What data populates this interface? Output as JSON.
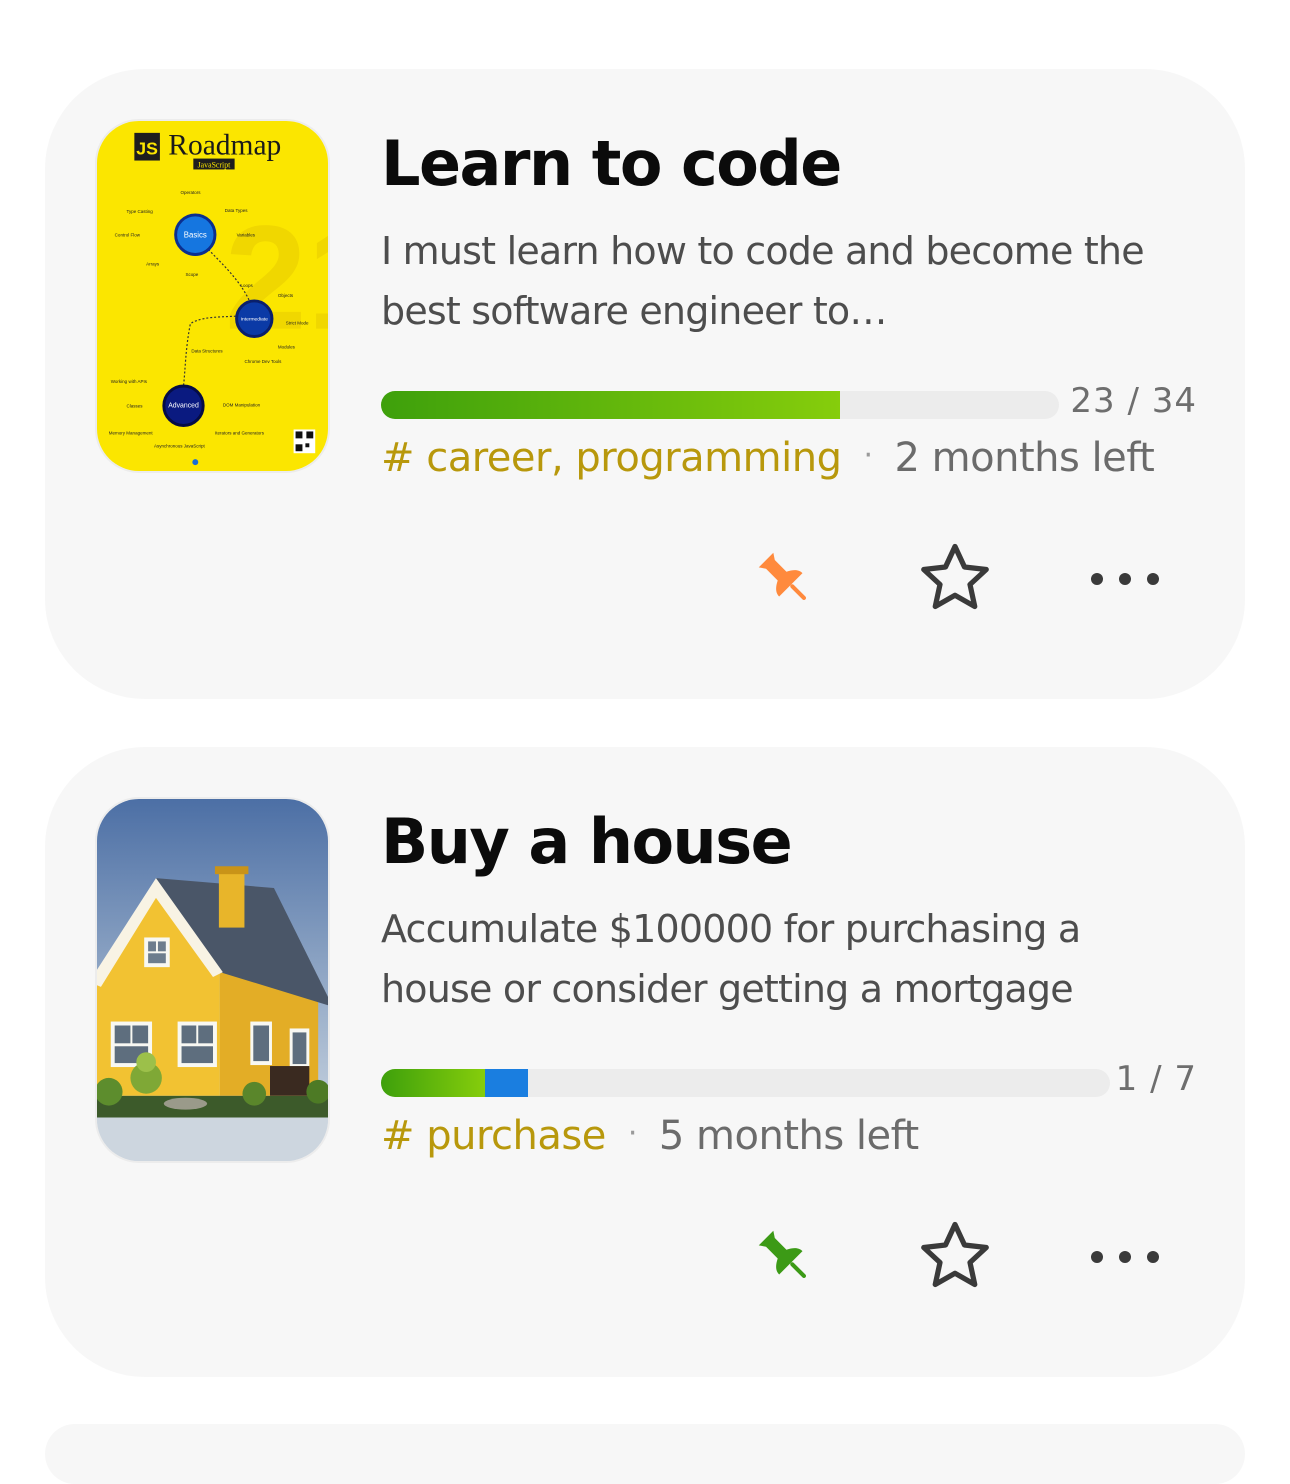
{
  "goals": [
    {
      "title": "Learn to code",
      "description": "I must learn how to code and become the best software engineer to…",
      "progress": {
        "done": 23,
        "total": 34,
        "label": "23 / 34"
      },
      "tags": "# career, programming",
      "separator": "·",
      "deadline": "2 months left",
      "pinned": true,
      "pin_color": "#ff8a3d",
      "thumbnail": {
        "type": "roadmap-poster",
        "badge": "JS",
        "heading": "Roadmap",
        "subheading": "JavaScript",
        "nodes": [
          "Basics",
          "Intermediate",
          "Advanced"
        ],
        "topics": [
          "Operators",
          "Type Casting",
          "Data Types",
          "Control Flow",
          "Variables",
          "Arrays",
          "Scope",
          "Loops",
          "Objects",
          "Strict Mode",
          "Modules",
          "Data Structures",
          "Chrome Dev Tools",
          "Working with APIs",
          "Classes",
          "DOM Manipulation",
          "Memory Management",
          "Iterators and Generators",
          "Asynchronous JavaScript"
        ]
      },
      "actions": [
        "pin-icon",
        "star-icon",
        "more-icon"
      ]
    },
    {
      "title": "Buy a house",
      "description": "Accumulate $100000 for purchasing a house or consider getting a mortgage",
      "progress": {
        "done": 1,
        "total": 7,
        "label": "1 / 7"
      },
      "tags": "# purchase",
      "separator": "·",
      "deadline": "5 months left",
      "pinned": true,
      "pin_color": "#3c9a16",
      "thumbnail": {
        "type": "house-photo"
      },
      "actions": [
        "pin-icon",
        "star-icon",
        "more-icon"
      ]
    }
  ],
  "colors": {
    "progress_start": "#3ea00c",
    "progress_end": "#86cd0c",
    "progress_blue": "#1a7ee0",
    "tag": "#b8980c",
    "card_bg": "#f7f7f7"
  }
}
